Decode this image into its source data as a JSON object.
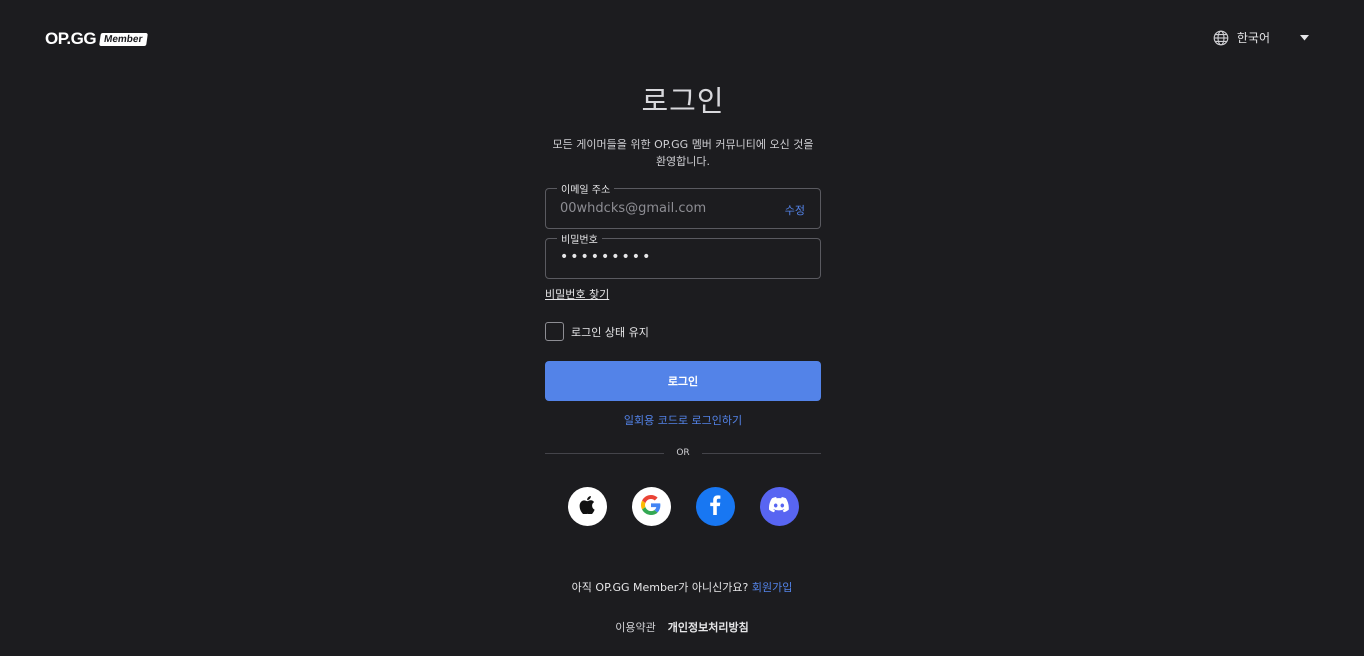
{
  "header": {
    "logo_text": "OP.GG",
    "logo_badge": "Member",
    "language": "한국어",
    "language_icon": "globe-icon",
    "dropdown_icon": "caret-down-icon"
  },
  "form": {
    "title": "로그인",
    "subtitle_line1": "모든 게이머들을 위한 OP.GG 멤버 커뮤니티에 오신 것을",
    "subtitle_line2": "환영합니다.",
    "email_label": "이메일 주소",
    "email_value": "00whdcks@gmail.com",
    "email_edit": "수정",
    "password_label": "비밀번호",
    "password_value": "•••••••••",
    "find_password": "비밀번호 찾기",
    "remember_label": "로그인 상태 유지",
    "login_button": "로그인",
    "otp_link": "일회용 코드로 로그인하기",
    "or_text": "OR"
  },
  "socials": [
    {
      "name": "apple",
      "icon": "apple-icon"
    },
    {
      "name": "google",
      "icon": "google-icon"
    },
    {
      "name": "facebook",
      "icon": "facebook-icon"
    },
    {
      "name": "discord",
      "icon": "discord-icon"
    }
  ],
  "signup": {
    "prompt": "아직 OP.GG Member가 아니신가요?",
    "link": "회원가입"
  },
  "footer": {
    "terms": "이용약관",
    "privacy": "개인정보처리방침"
  },
  "colors": {
    "background": "#1c1c1f",
    "accent": "#5383e8",
    "facebook": "#1877f2",
    "discord": "#5865f2"
  }
}
